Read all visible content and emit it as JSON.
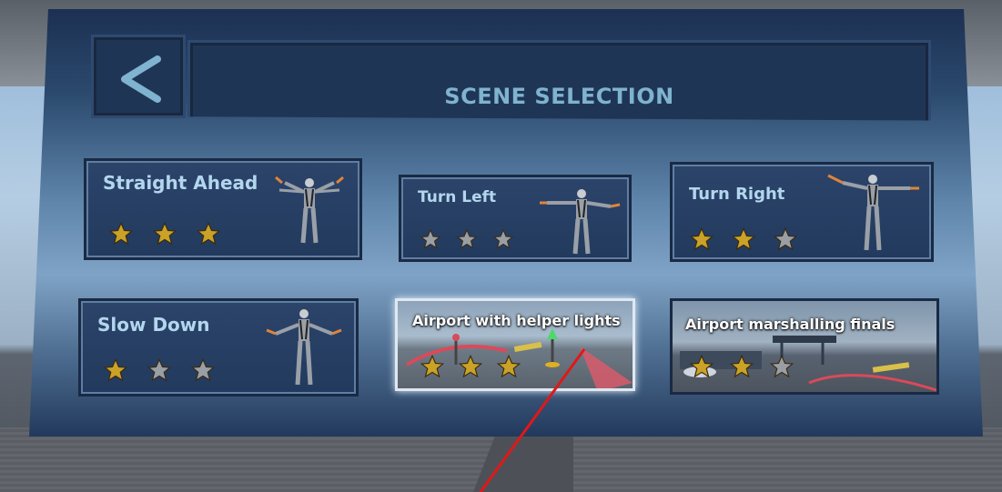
{
  "header": {
    "title": "SCENE SELECTION",
    "back_icon": "chevron-left-icon"
  },
  "cards": [
    {
      "label": "Straight Ahead",
      "stars_earned": 3,
      "stars_total": 3
    },
    {
      "label": "Turn Left",
      "stars_earned": 0,
      "stars_total": 3
    },
    {
      "label": "Turn Right",
      "stars_earned": 2,
      "stars_total": 3
    },
    {
      "label": "Slow Down",
      "stars_earned": 1,
      "stars_total": 3
    },
    {
      "label": "Airport with helper lights",
      "stars_earned": 3,
      "stars_total": 3,
      "selected": true
    },
    {
      "label": "Airport marshalling finals",
      "stars_earned": 2,
      "stars_total": 3
    }
  ],
  "colors": {
    "star_gold": "#c9a227",
    "star_silver": "#9a9ea5",
    "title_text": "#7fb3cf",
    "pointer": "#e01818"
  }
}
